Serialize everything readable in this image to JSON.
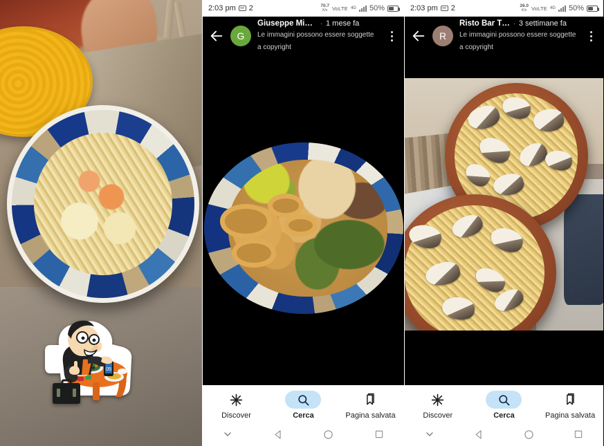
{
  "left_photo": {
    "name": "seafood-spaghetti-photo",
    "description": "Spaghetti allo scoglio in ornate blue and white ceramic bowl on wooden table",
    "sticker": {
      "name": "cartoon-diner-sticker",
      "description": "Cartoon man with glasses eating at an orange table with a smartphone and briefcase"
    }
  },
  "phones": [
    {
      "id": "middle",
      "status": {
        "time": "2:03 pm",
        "notif_count": "2",
        "net_speed_value": "70.7",
        "net_speed_unit": "K/s",
        "volte": "VoLTE",
        "network": "4G",
        "battery": "50%",
        "battery_level": 50
      },
      "appbar": {
        "back_label": "Indietro",
        "avatar_letter": "G",
        "avatar_color": "#6aa83c",
        "name": "Giuseppe Mina…",
        "separator": "·",
        "when": "1 mese fa",
        "subtitle": "Le immagini possono essere soggette a copyright",
        "menu_label": "Altre opzioni"
      },
      "photo": {
        "name": "fried-mixed-platter-photo",
        "description": "Fritto misto with calamari rings, fried zucchini and eggplant on a decorated ceramic plate"
      }
    },
    {
      "id": "right",
      "status": {
        "time": "2:03 pm",
        "notif_count": "2",
        "net_speed_value": "26.0",
        "net_speed_unit": "K/s",
        "volte": "VoLTE",
        "network": "4G",
        "battery": "50%",
        "battery_level": 50
      },
      "appbar": {
        "back_label": "Indietro",
        "avatar_letter": "R",
        "avatar_color": "#9c7f72",
        "name": "Risto Bar T…",
        "separator": "·",
        "when": "3 settimane fa",
        "subtitle": "Le immagini possono essere soggette a copyright",
        "menu_label": "Altre opzioni"
      },
      "photo": {
        "name": "spaghetti-vongole-photo",
        "description": "Two terracotta bowls of spaghetti alle vongole"
      }
    }
  ],
  "bottom_nav": {
    "items": [
      {
        "label": "Discover",
        "icon": "sparkle-icon",
        "active": false
      },
      {
        "label": "Cerca",
        "icon": "search-icon",
        "active": true
      },
      {
        "label": "Pagina salvata",
        "icon": "bookmark-icon",
        "active": false
      }
    ],
    "active_pill_color": "#c5e3f6"
  },
  "system_nav": {
    "items": [
      {
        "label": "Nascondi",
        "icon": "chevron-down-icon"
      },
      {
        "label": "Indietro",
        "icon": "back-triangle-icon"
      },
      {
        "label": "Home",
        "icon": "home-circle-icon"
      },
      {
        "label": "Recenti",
        "icon": "recents-square-icon"
      }
    ]
  }
}
